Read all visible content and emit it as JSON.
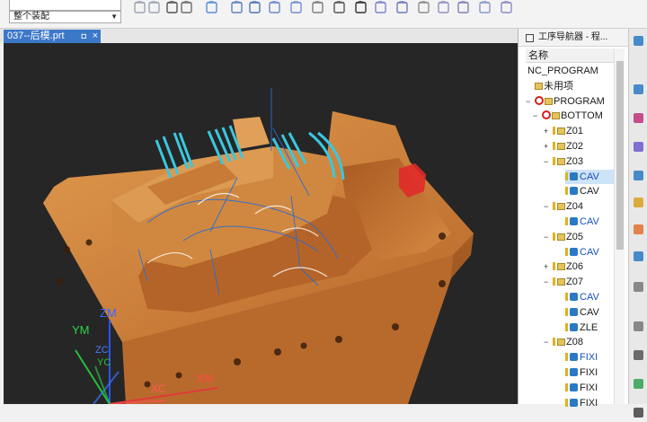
{
  "toolbar": {
    "filter_select": "",
    "assembly_select": "整个装配"
  },
  "tab": {
    "title": "037--后模.prt",
    "pin": "◘",
    "close": "×"
  },
  "viewport": {
    "axis_labels": {
      "zm": "ZM",
      "ym": "YM",
      "xm": "XM",
      "zc": "ZC",
      "yc": "YC",
      "xc": "XC"
    }
  },
  "panel": {
    "title": "工序导航器 - 程...",
    "column_header": "名称",
    "tree": [
      {
        "label": "NC_PROGRAM",
        "level": 0,
        "expander": "",
        "icon": "none"
      },
      {
        "label": "未用项",
        "level": 1,
        "expander": "",
        "icon": "folder"
      },
      {
        "label": "PROGRAM",
        "level": 1,
        "expander": "−",
        "icon": "noentry-folder"
      },
      {
        "label": "BOTTOM",
        "level": 2,
        "expander": "−",
        "icon": "noentry-folder"
      },
      {
        "label": "Z01",
        "level": 3,
        "expander": "+",
        "icon": "pin-folder"
      },
      {
        "label": "Z02",
        "level": 3,
        "expander": "+",
        "icon": "pin-folder"
      },
      {
        "label": "Z03",
        "level": 3,
        "expander": "−",
        "icon": "pin-folder"
      },
      {
        "label": "CAV",
        "level": 4,
        "expander": "",
        "icon": "op",
        "highlight": true
      },
      {
        "label": "CAV",
        "level": 4,
        "expander": "",
        "icon": "op"
      },
      {
        "label": "Z04",
        "level": 3,
        "expander": "−",
        "icon": "pin-folder"
      },
      {
        "label": "CAV",
        "level": 4,
        "expander": "",
        "icon": "op",
        "blue": true
      },
      {
        "label": "Z05",
        "level": 3,
        "expander": "−",
        "icon": "pin-folder"
      },
      {
        "label": "CAV",
        "level": 4,
        "expander": "",
        "icon": "op",
        "blue": true
      },
      {
        "label": "Z06",
        "level": 3,
        "expander": "+",
        "icon": "pin-folder"
      },
      {
        "label": "Z07",
        "level": 3,
        "expander": "−",
        "icon": "pin-folder"
      },
      {
        "label": "CAV",
        "level": 4,
        "expander": "",
        "icon": "op",
        "blue": true
      },
      {
        "label": "CAV",
        "level": 4,
        "expander": "",
        "icon": "op"
      },
      {
        "label": "ZLE",
        "level": 4,
        "expander": "",
        "icon": "op"
      },
      {
        "label": "Z08",
        "level": 3,
        "expander": "−",
        "icon": "pin-folder"
      },
      {
        "label": "FIXI",
        "level": 4,
        "expander": "",
        "icon": "op",
        "blue": true
      },
      {
        "label": "FIXI",
        "level": 4,
        "expander": "",
        "icon": "op"
      },
      {
        "label": "FIXI",
        "level": 4,
        "expander": "",
        "icon": "op"
      },
      {
        "label": "FIXI",
        "level": 4,
        "expander": "",
        "icon": "op"
      }
    ]
  },
  "colors": {
    "accent": "#3c78c8",
    "part_main": "#c9772f",
    "toolpath": "#39c8e0",
    "highlight_red": "#e02a2a"
  }
}
